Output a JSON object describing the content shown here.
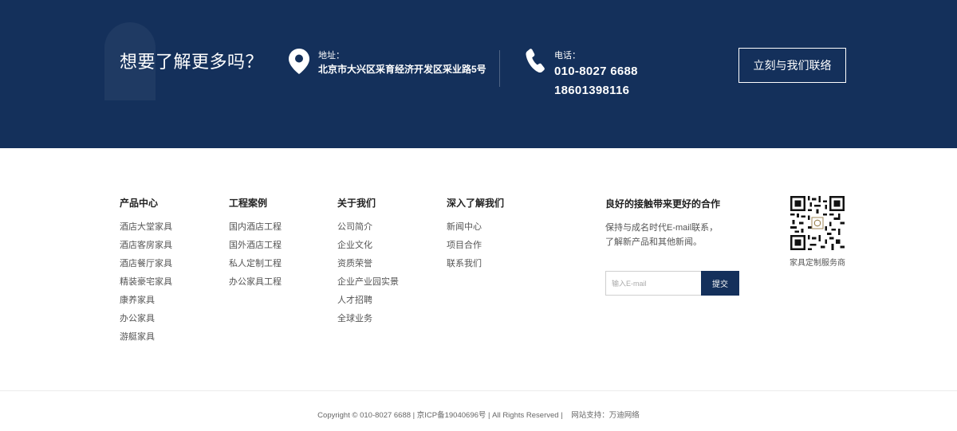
{
  "contact": {
    "headline": "想要了解更多吗？",
    "address_label": "地址：",
    "address": "北京市大兴区采育经济开发区采业路5号",
    "phone_label": "电话：",
    "phone_1": "010-8027 6688",
    "phone_2": "18601398116",
    "cta_label": "立刻与我们联络",
    "icons": [
      "location-pin-icon",
      "phone-icon"
    ],
    "background_color": "#14305b"
  },
  "footer": {
    "columns": [
      {
        "title": "产品中心",
        "items": [
          "酒店大堂家具",
          "酒店客房家具",
          "酒店餐厅家具",
          "精装豪宅家具",
          "康养家具",
          "办公家具",
          "游艇家具"
        ]
      },
      {
        "title": "工程案例",
        "items": [
          "国内酒店工程",
          "国外酒店工程",
          "私人定制工程",
          "办公家具工程"
        ]
      },
      {
        "title": "关于我们",
        "items": [
          "公司简介",
          "企业文化",
          "资质荣誉",
          "企业产业园实景",
          "人才招聘",
          "全球业务"
        ]
      },
      {
        "title": "深入了解我们",
        "items": [
          "新闻中心",
          "项目合作",
          "联系我们"
        ]
      }
    ],
    "newsletter": {
      "title": "良好的接触带来更好的合作",
      "desc_line1": "保持与成名时代E-mail联系，",
      "desc_line2": "了解新产品和其他新闻。",
      "placeholder": "输入E-mail",
      "submit_label": "提交"
    },
    "qr_caption": "家具定制服务商"
  },
  "bottom": {
    "copyright": "Copyright © 010-8027 6688 | 京ICP备19040696号 | All Rights Reserved |",
    "support": "网站支持：万迪网络"
  }
}
